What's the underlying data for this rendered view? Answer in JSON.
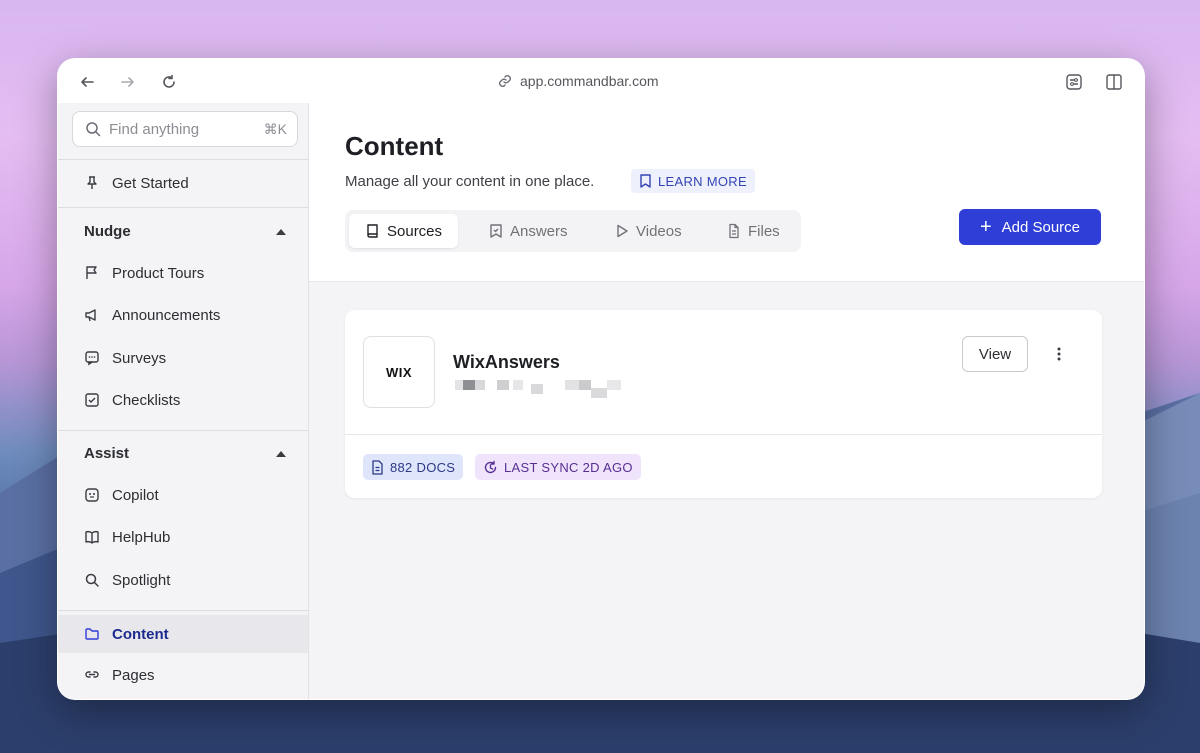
{
  "browser": {
    "url": "app.commandbar.com"
  },
  "sidebar": {
    "search_placeholder": "Find anything",
    "search_shortcut": "⌘K",
    "get_started": "Get Started",
    "nudge_label": "Nudge",
    "nudge_items": [
      "Product Tours",
      "Announcements",
      "Surveys",
      "Checklists"
    ],
    "assist_label": "Assist",
    "assist_items": [
      "Copilot",
      "HelpHub",
      "Spotlight"
    ],
    "content": "Content",
    "pages": "Pages"
  },
  "main": {
    "title": "Content",
    "subtitle": "Manage all your content in one place.",
    "learn_more": "LEARN MORE",
    "tabs": [
      "Sources",
      "Answers",
      "Videos",
      "Files"
    ],
    "active_tab": "Sources",
    "add_source": "Add Source"
  },
  "source_card": {
    "logo_text": "WIX",
    "name": "WixAnswers",
    "view_button": "View",
    "docs_badge": "882 DOCS",
    "sync_badge": "LAST SYNC 2D AGO"
  },
  "colors": {
    "accent": "#2f3ed6",
    "docs_badge_bg": "#dfe5fb",
    "sync_badge_bg": "#efe4fb"
  }
}
